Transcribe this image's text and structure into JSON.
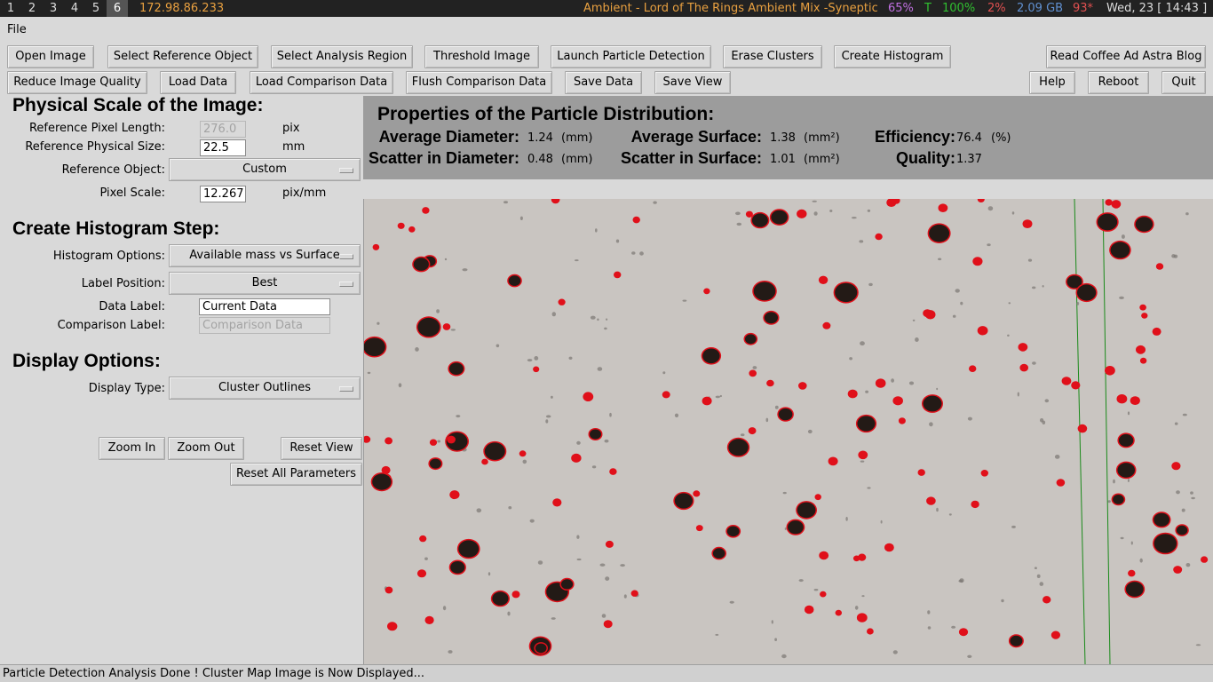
{
  "topbar": {
    "workspaces": [
      "1",
      "2",
      "3",
      "4",
      "5",
      "6"
    ],
    "active_workspace": "6",
    "ip": "172.98.86.233",
    "media": "Ambient - Lord of The Rings Ambient Mix -Syneptic",
    "volume": "65%",
    "battery_label": "T",
    "battery": "100%",
    "cpu": "2%",
    "memory": "2.09 GB",
    "temperature": "93*",
    "datetime": "Wed, 23 [ 14:43 ]",
    "colors": {
      "ip": "#e8a040",
      "media": "#e8a040",
      "volume": "#c070e0",
      "battery": "#30c030",
      "cpu": "#e05050",
      "memory": "#6090d0",
      "temperature": "#e05050"
    }
  },
  "menubar": {
    "file": "File"
  },
  "toolbar": {
    "row1": {
      "open_image": "Open Image",
      "select_reference": "Select Reference Object",
      "select_region": "Select Analysis Region",
      "threshold": "Threshold Image",
      "launch_detection": "Launch Particle Detection",
      "erase_clusters": "Erase Clusters",
      "create_histogram": "Create Histogram",
      "read_blog": "Read Coffee Ad Astra Blog"
    },
    "row2": {
      "reduce_quality": "Reduce Image Quality",
      "load_data": "Load Data",
      "load_comparison": "Load Comparison Data",
      "flush_comparison": "Flush Comparison Data",
      "save_data": "Save Data",
      "save_view": "Save View",
      "help": "Help",
      "reboot": "Reboot",
      "quit": "Quit"
    }
  },
  "scale": {
    "title": "Physical Scale of the Image:",
    "ref_pixel_label": "Reference Pixel Length:",
    "ref_pixel_value": "276.0",
    "ref_pixel_unit": "pix",
    "ref_physical_label": "Reference Physical Size:",
    "ref_physical_value": "22.5",
    "ref_physical_unit": "mm",
    "ref_object_label": "Reference Object:",
    "ref_object_value": "Custom",
    "pixel_scale_label": "Pixel Scale:",
    "pixel_scale_value": "12.267",
    "pixel_scale_unit": "pix/mm"
  },
  "histogram": {
    "title": "Create Histogram Step:",
    "options_label": "Histogram Options:",
    "options_value": "Available mass vs Surface",
    "label_position_label": "Label Position:",
    "label_position_value": "Best",
    "data_label_label": "Data Label:",
    "data_label_value": "Current Data",
    "comparison_label_label": "Comparison Label:",
    "comparison_label_placeholder": "Comparison Data"
  },
  "display": {
    "title": "Display Options:",
    "type_label": "Display Type:",
    "type_value": "Cluster Outlines"
  },
  "view_controls": {
    "zoom_in": "Zoom In",
    "zoom_out": "Zoom Out",
    "reset_view": "Reset View",
    "reset_all": "Reset All Parameters"
  },
  "properties": {
    "title": "Properties of the Particle Distribution:",
    "avg_diameter_label": "Average Diameter:",
    "avg_diameter_value": "1.24",
    "avg_diameter_unit": "(mm)",
    "scatter_diameter_label": "Scatter in Diameter:",
    "scatter_diameter_value": "0.48",
    "scatter_diameter_unit": "(mm)",
    "avg_surface_label": "Average Surface:",
    "avg_surface_value": "1.38",
    "avg_surface_unit": "(mm²)",
    "scatter_surface_label": "Scatter in Surface:",
    "scatter_surface_value": "1.01",
    "scatter_surface_unit": "(mm²)",
    "efficiency_label": "Efficiency:",
    "efficiency_value": "76.4",
    "efficiency_unit": "(%)",
    "quality_label": "Quality:",
    "quality_value": "1.37"
  },
  "status": "Particle Detection Analysis Done ! Cluster Map Image is Now Displayed..."
}
